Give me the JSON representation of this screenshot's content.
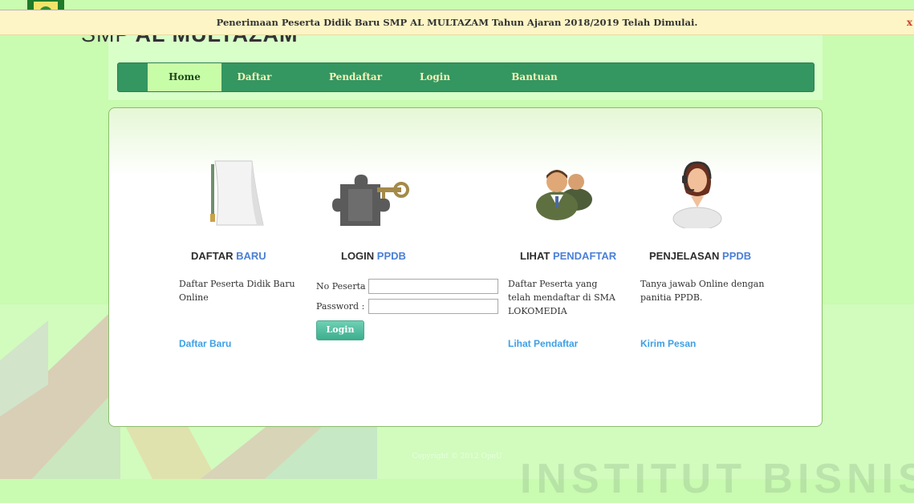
{
  "notice": {
    "text": "Penerimaan Peserta Didik Baru SMP AL MULTAZAM Tahun Ajaran 2018/2019 Telah Dimulai.",
    "close": "x"
  },
  "site": {
    "title_light": "SMP",
    "title_bold": "AL MULTAZAM"
  },
  "nav": {
    "items": [
      "Home",
      "Daftar",
      "Pendaftar",
      "Login",
      "Bantuan"
    ],
    "active": "Home"
  },
  "sections": {
    "daftar": {
      "title_dark": "DAFTAR",
      "title_accent": "BARU",
      "desc": "Daftar Peserta Didik Baru Online",
      "link": "Daftar Baru",
      "icon": "document-icon"
    },
    "login": {
      "title_dark": "LOGIN",
      "title_accent": "PPDB",
      "peserta_label": "No Peserta :",
      "password_label": "Password  :",
      "peserta_value": "",
      "password_value": "",
      "button": "Login",
      "icon": "puzzle-key-icon"
    },
    "pendaftar": {
      "title_dark": "LIHAT",
      "title_accent": "PENDAFTAR",
      "desc": "Daftar Peserta yang telah mendaftar di SMA LOKOMEDIA",
      "link": "Lihat Pendaftar",
      "icon": "users-icon"
    },
    "penjelasan": {
      "title_dark": "PENJELASAN",
      "title_accent": "PPDB",
      "desc": "Tanya jawab Online dengan panitia PPDB.",
      "link": "Kirim Pesan",
      "icon": "support-agent-icon"
    }
  },
  "footer": {
    "copyright": "Copyright © 2012 OpeU"
  },
  "watermark": {
    "text": "INSTITUT BISNIS"
  },
  "colors": {
    "background": "#c9fbb0",
    "nav": "#349661",
    "nav_active": "#c8fda8",
    "accent_title": "#4b7fd6",
    "link": "#3da0e5",
    "login_button": "#3cae8e"
  }
}
